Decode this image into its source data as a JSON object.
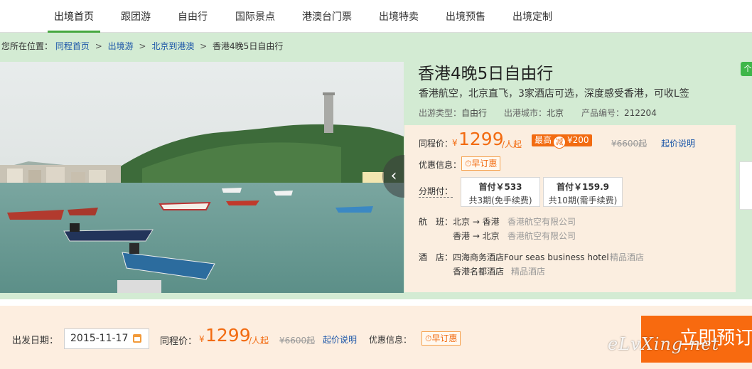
{
  "nav": {
    "tabs": [
      "出境首页",
      "跟团游",
      "自由行",
      "国际景点",
      "港澳台门票",
      "出境特卖",
      "出境预售",
      "出境定制"
    ],
    "active_index": 0
  },
  "breadcrumb": {
    "prefix": "您所在位置：",
    "items": [
      "同程首页",
      "出境游",
      "北京到港澳"
    ],
    "current": "香港4晚5日自由行",
    "separator": ">"
  },
  "product": {
    "title": "香港4晚5日自由行",
    "subtitle": "香港航空，北京直飞，3家酒店可选，深度感受香港，可收L签",
    "type_label": "出游类型：",
    "type_value": "自由行",
    "city_label": "出港城市：",
    "city_value": "北京",
    "id_label": "产品编号：",
    "id_value": "212204",
    "badge": "个"
  },
  "pricing": {
    "label": "同程价：",
    "currency": "¥",
    "price": "1299",
    "unit": "/人起",
    "max_label": "最高",
    "discount_icon": "减",
    "discount": "¥200",
    "original": "¥6600起",
    "explain_link": "起价说明",
    "promo_label": "优惠信息：",
    "promo_tag": "早订惠",
    "installment_label": "分期付：",
    "installments": [
      {
        "first": "首付￥533",
        "desc": "共3期(免手续费)"
      },
      {
        "first": "首付￥159.9",
        "desc": "共10期(需手续费)"
      }
    ]
  },
  "flights": {
    "label": "航　班：",
    "rows": [
      {
        "route": "北京 → 香港",
        "airline": "香港航空有限公司"
      },
      {
        "route": "香港 → 北京",
        "airline": "香港航空有限公司"
      }
    ]
  },
  "hotels": {
    "label": "酒　店：",
    "rows": [
      {
        "name": "四海商务酒店Four seas business hotel",
        "grade": "精品酒店"
      },
      {
        "name": "香港名都酒店",
        "grade": "精品酒店"
      }
    ]
  },
  "booking": {
    "date_label": "出发日期：",
    "date_value": "2015-11-17",
    "price_label": "同程价：",
    "currency": "¥",
    "price": "1299",
    "unit": "/人起",
    "original": "¥6600起",
    "explain_link": "起价说明",
    "promo_label": "优惠信息：",
    "promo_tag": "早订惠",
    "cta": "立即预订"
  },
  "watermark": "eLvXing.net",
  "icons": {
    "prev": "chevron-left-icon",
    "calendar": "calendar-icon",
    "clock": "clock-icon"
  },
  "colors": {
    "accent": "#f26b11",
    "green_band": "#d3ebd3",
    "nav_active": "#46a740",
    "link": "#1a55a8"
  }
}
